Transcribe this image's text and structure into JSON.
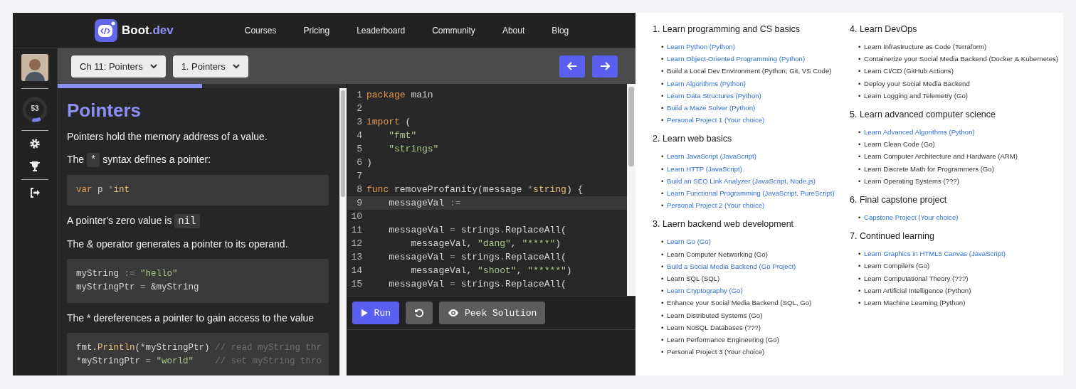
{
  "nav": {
    "logo": {
      "name": "Boot",
      "suffix": ".dev"
    },
    "links": [
      "Courses",
      "Pricing",
      "Leaderboard",
      "Community",
      "About",
      "Blog"
    ]
  },
  "toolbar": {
    "dropdowns": [
      "Ch 11: Pointers",
      "1. Pointers"
    ],
    "progress": {
      "level": 0.5
    }
  },
  "sidebar": {
    "xp": "53",
    "xp_ring": {
      "level": 0.12
    }
  },
  "lesson": {
    "title": "Pointers",
    "blocks": [
      {
        "kind": "paragraph",
        "parts": [
          {
            "kind": "text",
            "text": "Pointers hold the memory address of a value."
          }
        ]
      },
      {
        "kind": "paragraph",
        "parts": [
          {
            "kind": "text",
            "text": "The "
          },
          {
            "kind": "code",
            "text": "*"
          },
          {
            "kind": "text",
            "text": " syntax defines a pointer:"
          }
        ]
      },
      {
        "kind": "code",
        "lines": [
          [
            {
              "kind": "kw",
              "text": "var"
            },
            {
              "kind": "plain",
              "text": " p "
            },
            {
              "kind": "op",
              "text": "*"
            },
            {
              "kind": "type",
              "text": "int"
            }
          ]
        ]
      },
      {
        "kind": "paragraph",
        "parts": [
          {
            "kind": "text",
            "text": "A pointer's zero value is "
          },
          {
            "kind": "code",
            "text": "nil"
          }
        ]
      },
      {
        "kind": "paragraph",
        "parts": [
          {
            "kind": "text",
            "text": "The & operator generates a pointer to its operand."
          }
        ]
      },
      {
        "kind": "code",
        "lines": [
          [
            {
              "kind": "plain",
              "text": "myString "
            },
            {
              "kind": "op",
              "text": ":="
            },
            {
              "kind": "str",
              "text": " \"hello\""
            }
          ],
          [
            {
              "kind": "plain",
              "text": "myStringPtr "
            },
            {
              "kind": "op",
              "text": "="
            },
            {
              "kind": "plain",
              "text": " &myString"
            }
          ]
        ]
      },
      {
        "kind": "paragraph",
        "parts": [
          {
            "kind": "text",
            "text": "The * dereferences a pointer to gain access to the value"
          }
        ]
      },
      {
        "kind": "code",
        "lines": [
          [
            {
              "kind": "plain",
              "text": "fmt."
            },
            {
              "kind": "fn",
              "text": "Println"
            },
            {
              "kind": "plain",
              "text": "(*myStringPtr) "
            },
            {
              "kind": "com",
              "text": "// read myString thr"
            }
          ],
          [
            {
              "kind": "plain",
              "text": "*myStringPtr "
            },
            {
              "kind": "op",
              "text": "="
            },
            {
              "kind": "str",
              "text": " \"world\""
            },
            {
              "kind": "com",
              "text": "    // set myString thro"
            }
          ]
        ]
      }
    ]
  },
  "editor": {
    "lines": [
      {
        "number": "1",
        "active": false,
        "tokens": [
          {
            "kind": "kw",
            "text": "package"
          },
          {
            "kind": "plain",
            "text": " main"
          }
        ]
      },
      {
        "number": "2",
        "active": false
      },
      {
        "number": "3",
        "active": false,
        "tokens": [
          {
            "kind": "kw",
            "text": "import"
          },
          {
            "kind": "plain",
            "text": " ("
          }
        ]
      },
      {
        "number": "4",
        "active": false,
        "tokens": [
          {
            "kind": "str",
            "text": "    \"fmt\""
          }
        ]
      },
      {
        "number": "5",
        "active": false,
        "tokens": [
          {
            "kind": "str",
            "text": "    \"strings\""
          }
        ]
      },
      {
        "number": "6",
        "active": false,
        "tokens": [
          {
            "kind": "plain",
            "text": ")"
          }
        ]
      },
      {
        "number": "7",
        "active": false
      },
      {
        "number": "8",
        "active": false,
        "tokens": [
          {
            "kind": "kw",
            "text": "func"
          },
          {
            "kind": "plain",
            "text": " removeProfanity(message "
          },
          {
            "kind": "op",
            "text": "*"
          },
          {
            "kind": "type",
            "text": "string"
          },
          {
            "kind": "plain",
            "text": ") {"
          }
        ]
      },
      {
        "number": "9",
        "active": true,
        "tokens": [
          {
            "kind": "plain",
            "text": "    messageVal "
          },
          {
            "kind": "op",
            "text": ":="
          }
        ]
      },
      {
        "number": "10",
        "active": false
      },
      {
        "number": "11",
        "active": false,
        "tokens": [
          {
            "kind": "plain",
            "text": "    messageVal "
          },
          {
            "kind": "op",
            "text": "="
          },
          {
            "kind": "plain",
            "text": " strings"
          },
          {
            "kind": "op",
            "text": "."
          },
          {
            "kind": "plain",
            "text": "ReplaceAll("
          }
        ]
      },
      {
        "number": "12",
        "active": false,
        "tokens": [
          {
            "kind": "plain",
            "text": "        messageVal, "
          },
          {
            "kind": "str",
            "text": "\"dang\""
          },
          {
            "kind": "plain",
            "text": ", "
          },
          {
            "kind": "str",
            "text": "\"****\""
          },
          {
            "kind": "plain",
            "text": ")"
          }
        ]
      },
      {
        "number": "13",
        "active": false,
        "tokens": [
          {
            "kind": "plain",
            "text": "    messageVal "
          },
          {
            "kind": "op",
            "text": "="
          },
          {
            "kind": "plain",
            "text": " strings"
          },
          {
            "kind": "op",
            "text": "."
          },
          {
            "kind": "plain",
            "text": "ReplaceAll("
          }
        ]
      },
      {
        "number": "14",
        "active": false,
        "tokens": [
          {
            "kind": "plain",
            "text": "        messageVal, "
          },
          {
            "kind": "str",
            "text": "\"shoot\""
          },
          {
            "kind": "plain",
            "text": ", "
          },
          {
            "kind": "str",
            "text": "\"*****\""
          },
          {
            "kind": "plain",
            "text": ")"
          }
        ]
      },
      {
        "number": "15",
        "active": false,
        "tokens": [
          {
            "kind": "plain",
            "text": "    messageVal "
          },
          {
            "kind": "op",
            "text": "="
          },
          {
            "kind": "plain",
            "text": " strings"
          },
          {
            "kind": "op",
            "text": "."
          },
          {
            "kind": "plain",
            "text": "ReplaceAll("
          }
        ]
      }
    ],
    "buttons": [
      {
        "kind": "run",
        "label": "Run"
      },
      {
        "kind": "reset"
      },
      {
        "kind": "peek",
        "label": "Peek Solution"
      }
    ]
  },
  "roadmap": {
    "columns": [
      [
        {
          "heading": "1. Learn programming and CS basics",
          "bullet": "•",
          "items": [
            {
              "text": "Learn Python (Python)",
              "linked": true
            },
            {
              "text": "Learn Object-Oriented Programming (Python)",
              "linked": true
            },
            {
              "text": "Build a Local Dev Environment (Python, Git, VS Code)",
              "linked": false
            },
            {
              "text": "Learn Algorithms (Python)",
              "linked": true
            },
            {
              "text": "Learn Data Structures (Python)",
              "linked": true
            },
            {
              "text": "Build a Maze Solver (Python)",
              "linked": true
            },
            {
              "text": "Personal Project 1 (Your choice)",
              "linked": true
            }
          ]
        },
        {
          "heading": "2. Learn web basics",
          "bullet": "•",
          "items": [
            {
              "text": "Learn JavaScript (JavaScript)",
              "linked": true
            },
            {
              "text": "Learn HTTP (JavaScript)",
              "linked": true
            },
            {
              "text": "Build an SEO Link Analyzer (JavaScript, Node.js)",
              "linked": true
            },
            {
              "text": "Learn Functional Programming (JavaScript, PureScript)",
              "linked": true
            },
            {
              "text": "Personal Project 2 (Your choice)",
              "linked": true
            }
          ]
        },
        {
          "heading": "3. Laern backend web development",
          "bullet": "•",
          "items": [
            {
              "text": "Learn Go (Go)",
              "linked": true
            },
            {
              "text": "Learn Computer Networking (Go)",
              "linked": false
            },
            {
              "text": "Build a Social Media Backend (Go Project)",
              "linked": true
            },
            {
              "text": "Learn SQL (SQL)",
              "linked": false
            },
            {
              "text": "Learn Cryptography (Go)",
              "linked": true
            },
            {
              "text": "Enhance your Social Media Backend (SQL, Go)",
              "linked": false
            },
            {
              "text": "Learn Distributed Systems (Go)",
              "linked": false
            },
            {
              "text": "Learn NoSQL Databases (???)",
              "linked": false
            },
            {
              "text": "Learn Performance Engineering (Go)",
              "linked": false
            },
            {
              "text": "Personal Project 3 (Your choice)",
              "linked": false
            }
          ]
        }
      ],
      [
        {
          "heading": "4. Learn DevOps",
          "bullet": "•",
          "items": [
            {
              "text": "Learn Infrastructure as Code (Terraform)",
              "linked": false
            },
            {
              "text": "Containerize your Social Media Backend (Docker & Kubernetes)",
              "linked": false
            },
            {
              "text": "Learn CI/CD (GitHub Actions)",
              "linked": false
            },
            {
              "text": "Deploy your Social Media Backend",
              "linked": false
            },
            {
              "text": "Learn Logging and Telemetry (Go)",
              "linked": false
            }
          ]
        },
        {
          "heading": "5. Learn advanced computer science",
          "bullet": "•",
          "items": [
            {
              "text": "Learn Advanced Algorithms (Python)",
              "linked": true
            },
            {
              "text": "Learn Clean Code (Go)",
              "linked": false
            },
            {
              "text": "Learn Computer Architecture and Hardware (ARM)",
              "linked": false
            },
            {
              "text": "Learn Discrete Math for Programmers (Go)",
              "linked": false
            },
            {
              "text": "Learn Operating Systems (???)",
              "linked": false
            }
          ]
        },
        {
          "heading": "6. Final capstone project",
          "bullet": "•",
          "items": [
            {
              "text": "Capstone Project (Your choice)",
              "linked": true
            }
          ]
        },
        {
          "heading": "7. Continued learning",
          "bullet": "•",
          "items": [
            {
              "text": "Learn Graphics in HTML5 Canvas (JavaScript)",
              "linked": true
            },
            {
              "text": "Learn Compilers (Go)",
              "linked": false
            },
            {
              "text": "Learn Computational Theory (???)",
              "linked": false
            },
            {
              "text": "Learn Artificial Intelligence (Python)",
              "linked": false
            },
            {
              "text": "Learn Machine Learning (Python)",
              "linked": false
            }
          ]
        }
      ]
    ]
  }
}
